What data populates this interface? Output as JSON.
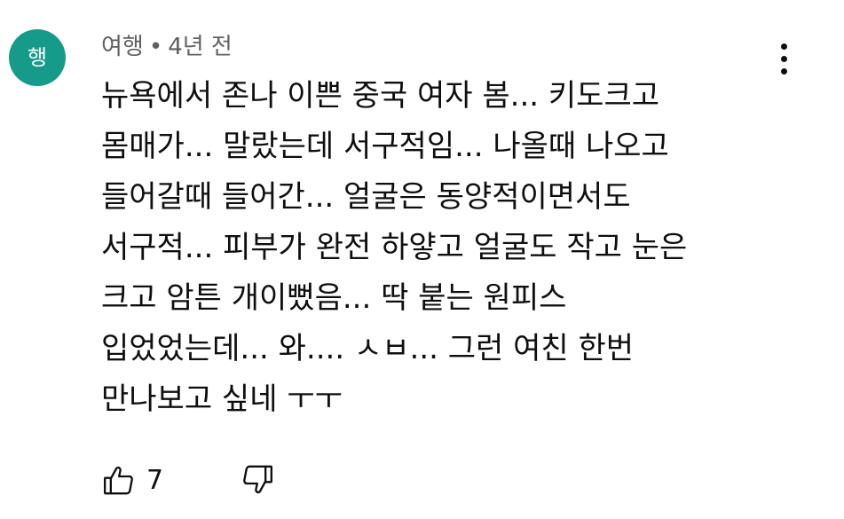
{
  "comment": {
    "avatar_initial": "행",
    "avatar_color": "#169a8a",
    "author": "여행",
    "separator": "•",
    "time_ago": "4년 전",
    "menu_icon": "more-vertical-icon",
    "lines": [
      "뉴욕에서 존나 이쁜 중국 여자 봄... 키도크고",
      "몸매가... 말랐는데 서구적임... 나올때 나오고",
      "들어갈때 들어간... 얼굴은 동양적이면서도",
      "서구적... 피부가 완전 하얗고 얼굴도 작고 눈은",
      "크고 암튼 개이뻤음... 딱 붙는 원피스",
      "입었었는데... 와.... ㅅㅂ... 그런 여친 한번",
      "만나보고 싶네 ㅜㅜ"
    ],
    "like_icon": "thumbs-up-icon",
    "like_count": "7",
    "dislike_icon": "thumbs-down-icon"
  }
}
